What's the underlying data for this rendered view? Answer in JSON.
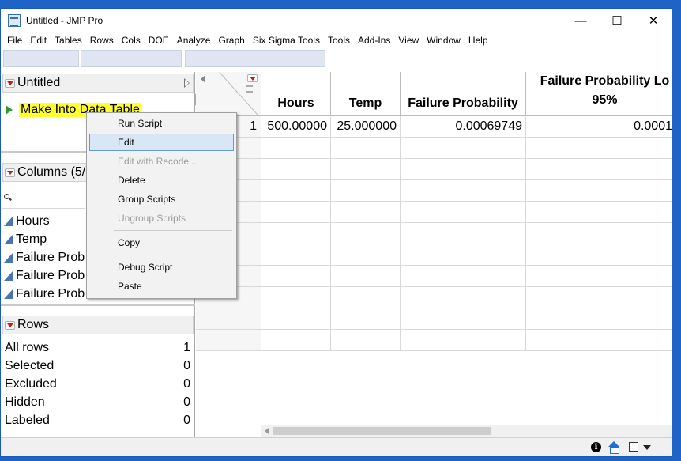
{
  "window": {
    "title": "Untitled - JMP Pro",
    "minimize": "—",
    "maximize": "☐",
    "close": "✕"
  },
  "menubar": [
    "File",
    "Edit",
    "Tables",
    "Rows",
    "Cols",
    "DOE",
    "Analyze",
    "Graph",
    "Six Sigma Tools",
    "Tools",
    "Add-Ins",
    "View",
    "Window",
    "Help"
  ],
  "toolbar": {
    "icons": [
      "new-data-table-icon",
      "new-script-icon",
      "open-icon",
      "save-icon",
      "cut-icon",
      "copy-icon",
      "paste-icon",
      "disabled-icon",
      "lock-icon",
      "data-grid-icon",
      "calculator-icon",
      "table-icon",
      "bar-icon",
      "formula-icon",
      "arrow-icon",
      "pencil-icon"
    ],
    "colors": [
      "#2a7ad5",
      "#e2a21a",
      "#e8b830",
      "#2356b3",
      "#888888",
      "#5d7fb8",
      "#c89a3a",
      "#b0b0b0",
      "#b0b0b0",
      "#e8a040",
      "#6a7a8a",
      "#7a9a5a",
      "#3c9a3c",
      "#444444",
      "#3aa03a",
      "#b0b0b0"
    ]
  },
  "table_panel": {
    "title": "Untitled",
    "script_label": "Make Into Data Table"
  },
  "columns_panel": {
    "title": "Columns (5/",
    "items": [
      "Hours",
      "Temp",
      "Failure Prob",
      "Failure Prob",
      "Failure Prob"
    ]
  },
  "rows_panel": {
    "title": "Rows",
    "stats": [
      {
        "label": "All rows",
        "value": "1"
      },
      {
        "label": "Selected",
        "value": "0"
      },
      {
        "label": "Excluded",
        "value": "0"
      },
      {
        "label": "Hidden",
        "value": "0"
      },
      {
        "label": "Labeled",
        "value": "0"
      }
    ]
  },
  "grid": {
    "headers": [
      "Hours",
      "Temp",
      "Failure Probability",
      "Failure Probability Lo 95%"
    ],
    "header_line1": [
      "",
      "",
      "",
      "Failure Probability Lo"
    ],
    "header_line2": [
      "Hours",
      "Temp",
      "Failure Probability",
      "95%"
    ],
    "rows": [
      {
        "num": "1",
        "cells": [
          "500.00000",
          "25.000000",
          "0.00069749",
          "0.0001"
        ]
      }
    ]
  },
  "context_menu": {
    "items": [
      {
        "label": "Run Script",
        "disabled": false
      },
      {
        "label": "Edit",
        "disabled": false,
        "highlighted": true
      },
      {
        "label": "Edit with Recode...",
        "disabled": true
      },
      {
        "label": "Delete",
        "disabled": false
      },
      {
        "label": "Group Scripts",
        "disabled": false
      },
      {
        "label": "Ungroup Scripts",
        "disabled": true
      },
      {
        "label": "Copy",
        "disabled": false
      },
      {
        "label": "Debug Script",
        "disabled": false
      },
      {
        "label": "Paste",
        "disabled": false
      }
    ]
  },
  "statusbar": {
    "info_icon": "i"
  }
}
